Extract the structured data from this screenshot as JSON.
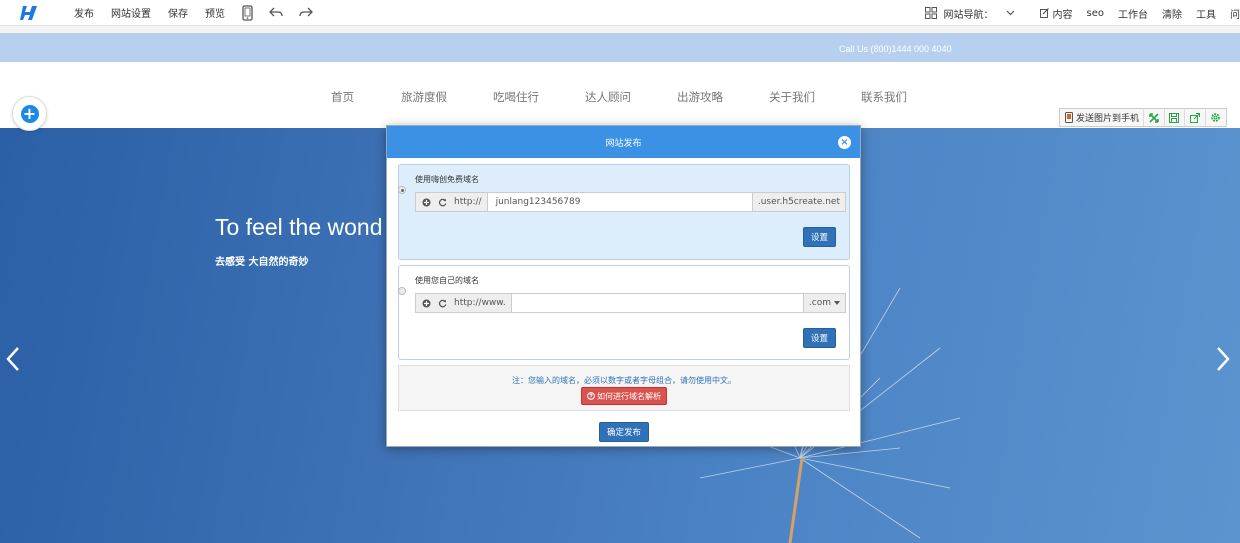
{
  "toolbar": {
    "publish": "发布",
    "site_settings": "网站设置",
    "save": "保存",
    "preview": "预览",
    "site_nav": "网站导航：",
    "content": "内容",
    "seo": "seo",
    "workbench": "工作台",
    "clear": "清除",
    "tools": "工具",
    "help_partial": "问"
  },
  "callbar": {
    "text": "Call Us (800)1444 000 4040"
  },
  "site_nav": {
    "items": [
      "首页",
      "旅游度假",
      "吃喝住行",
      "达人顾问",
      "出游攻略",
      "关于我们",
      "联系我们"
    ]
  },
  "mini_toolbar": {
    "send_label": "发送图片到手机"
  },
  "hero": {
    "title": "To feel the wond",
    "subtitle": "去感受 大自然的奇妙"
  },
  "modal": {
    "title": "网站发布",
    "free_domain": {
      "label": "使用嗨创免费域名",
      "prefix": "http://",
      "value": "junlang123456789",
      "suffix": ".user.h5create.net",
      "button": "设置"
    },
    "own_domain": {
      "label": "使用您自己的域名",
      "prefix": "http://www.",
      "value": "",
      "suffix": ".com",
      "button": "设置"
    },
    "note": "注：您输入的域名，必须以数字或者字母组合，请勿使用中文。",
    "help_button": "如何进行域名解析",
    "confirm_button": "确定发布"
  },
  "colors": {
    "accent": "#3b92e4",
    "primary_button": "#2f72b8",
    "danger_button": "#d9534f",
    "callbar": "#b8d0ef"
  }
}
